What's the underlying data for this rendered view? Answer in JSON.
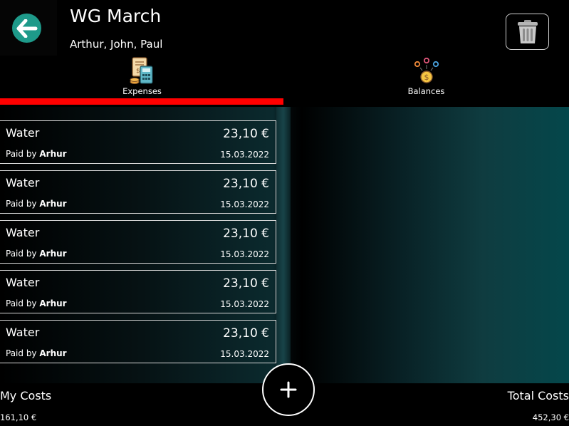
{
  "header": {
    "title": "WG March",
    "members": "Arthur, John, Paul",
    "back_icon": "arrow-left-icon",
    "delete_icon": "trash-icon"
  },
  "tabs": [
    {
      "label": "Expenses",
      "icon": "expenses-calculator-icon",
      "active": true
    },
    {
      "label": "Balances",
      "icon": "balances-coins-icon",
      "active": false
    }
  ],
  "expenses": [
    {
      "name": "Water",
      "amount": "23,10 €",
      "paid_prefix": "Paid by",
      "payer": "Arhur",
      "date": "15.03.2022"
    },
    {
      "name": "Water",
      "amount": "23,10 €",
      "paid_prefix": "Paid by",
      "payer": "Arhur",
      "date": "15.03.2022"
    },
    {
      "name": "Water",
      "amount": "23,10 €",
      "paid_prefix": "Paid by",
      "payer": "Arhur",
      "date": "15.03.2022"
    },
    {
      "name": "Water",
      "amount": "23,10 €",
      "paid_prefix": "Paid by",
      "payer": "Arhur",
      "date": "15.03.2022"
    },
    {
      "name": "Water",
      "amount": "23,10 €",
      "paid_prefix": "Paid by",
      "payer": "Arhur",
      "date": "15.03.2022"
    }
  ],
  "footer": {
    "my_costs_label": "My Costs",
    "my_costs_value": "161,10 €",
    "total_costs_label": "Total Costs",
    "total_costs_value": "452,30 €",
    "add_icon": "plus-icon"
  },
  "colors": {
    "accent_teal": "#1e9a8a",
    "active_tab_indicator": "#ff0000",
    "background": "#000000"
  }
}
